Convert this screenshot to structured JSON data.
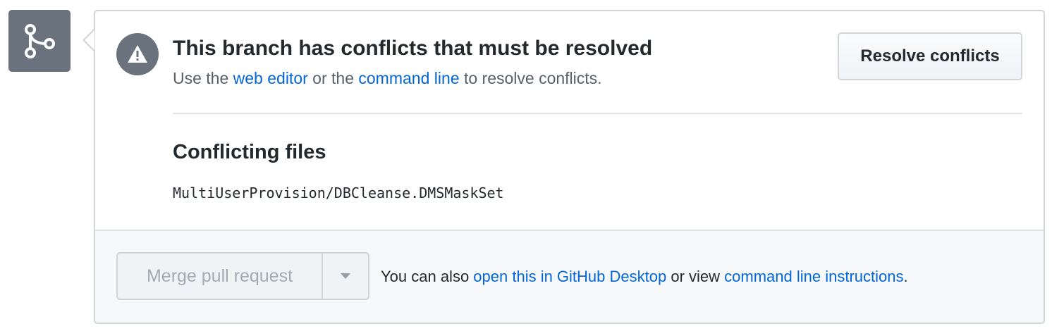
{
  "merge_icon": "git-merge-icon",
  "status": {
    "icon": "alert-icon",
    "title": "This branch has conflicts that must be resolved",
    "subtitle": {
      "prefix": "Use the ",
      "link_web_editor": "web editor",
      "middle": " or the ",
      "link_command_line": "command line",
      "suffix": " to resolve conflicts."
    },
    "resolve_button": "Resolve conflicts"
  },
  "conflicts": {
    "heading": "Conflicting files",
    "files": [
      "MultiUserProvision/DBCleanse.DMSMaskSet"
    ]
  },
  "footer": {
    "merge_button": "Merge pull request",
    "merge_dropdown_icon": "triangle-down-icon",
    "text_prefix": "You can also ",
    "link_desktop": "open this in GitHub Desktop",
    "text_middle": " or view ",
    "link_instructions": "command line instructions",
    "text_suffix": "."
  },
  "colors": {
    "link": "#0366d6",
    "icon_bg": "#6a737d",
    "footer_bg": "#f6f8fa",
    "disabled_text": "#a3aab1"
  }
}
